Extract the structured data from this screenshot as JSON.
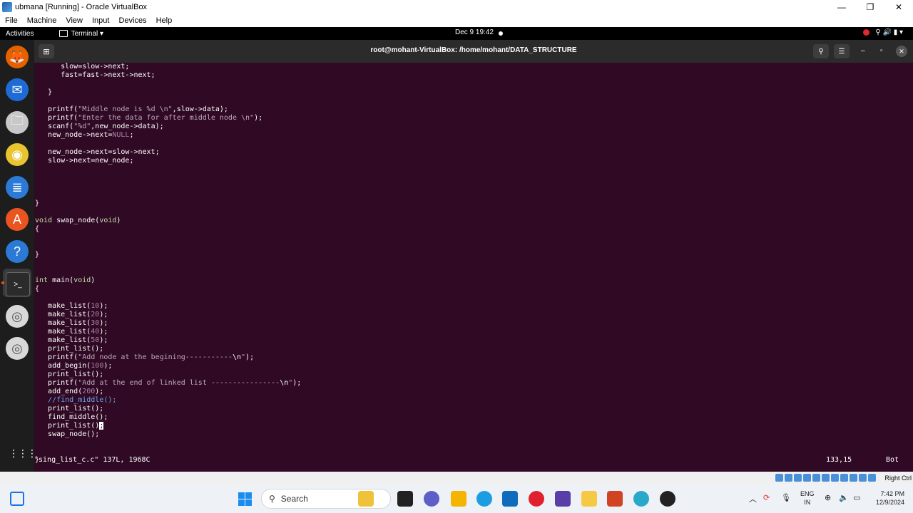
{
  "vbox": {
    "title": "ubmana [Running] - Oracle VirtualBox",
    "menu": [
      "File",
      "Machine",
      "View",
      "Input",
      "Devices",
      "Help"
    ],
    "minimize": "—",
    "restore": "❐",
    "close": "✕",
    "host_key": "Right Ctrl"
  },
  "ubuntu": {
    "activities": "Activities",
    "app_menu": "Terminal ▾",
    "clock": "Dec 9  19:42",
    "sys_icons": "⚲ 🔊 ▮ ▾"
  },
  "dock": {
    "items": [
      {
        "name": "firefox-icon",
        "glyph": "🦊",
        "color": "#e66000"
      },
      {
        "name": "thunderbird-icon",
        "glyph": "✉",
        "color": "#1f6bd6"
      },
      {
        "name": "files-icon",
        "glyph": "🗀",
        "color": "#c8c8c8"
      },
      {
        "name": "rhythmbox-icon",
        "glyph": "◉",
        "color": "#e8c430"
      },
      {
        "name": "writer-icon",
        "glyph": "≣",
        "color": "#2a7ad6"
      },
      {
        "name": "app-center-icon",
        "glyph": "A",
        "color": "#e95420"
      },
      {
        "name": "help-icon",
        "glyph": "?",
        "color": "#2a7ad6"
      },
      {
        "name": "terminal-icon",
        "glyph": ">_",
        "color": "#2b2b2b"
      },
      {
        "name": "disc-icon",
        "glyph": "◎",
        "color": "#d8d8d8"
      },
      {
        "name": "disc-icon-2",
        "glyph": "◎",
        "color": "#d8d8d8"
      }
    ],
    "show_apps": "⋮⋮⋮"
  },
  "terminal": {
    "new_tab": "⊞",
    "title": "root@mohant-VirtualBox: /home/mohant/DATA_STRUCTURE",
    "search": "⚲",
    "menu": "☰",
    "minimize": "–",
    "maximize": "▫",
    "close": "✕"
  },
  "code_lines": [
    [
      {
        "t": "      slow=slow->next;"
      }
    ],
    [
      {
        "t": "      fast=fast->next->next;"
      }
    ],
    [
      {
        "t": ""
      }
    ],
    [
      {
        "t": "   }"
      }
    ],
    [
      {
        "t": ""
      }
    ],
    [
      {
        "t": "   printf("
      },
      {
        "c": "str",
        "t": "\"Middle node is %d \\n\""
      },
      {
        "t": ",slow->data);"
      }
    ],
    [
      {
        "t": "   printf("
      },
      {
        "c": "str",
        "t": "\"Enter the data for after middle node \\n\""
      },
      {
        "t": ");"
      }
    ],
    [
      {
        "t": "   scanf("
      },
      {
        "c": "str",
        "t": "\"%d\""
      },
      {
        "t": ",new_node->data);"
      }
    ],
    [
      {
        "t": "   new_node->next="
      },
      {
        "c": "num",
        "t": "NULL"
      },
      {
        "t": ";"
      }
    ],
    [
      {
        "t": ""
      }
    ],
    [
      {
        "t": "   new_node->next=slow->next;"
      }
    ],
    [
      {
        "t": "   slow->next=new_node;"
      }
    ],
    [
      {
        "t": ""
      }
    ],
    [
      {
        "t": ""
      }
    ],
    [
      {
        "t": ""
      }
    ],
    [
      {
        "t": ""
      }
    ],
    [
      {
        "t": "}"
      }
    ],
    [
      {
        "t": ""
      }
    ],
    [
      {
        "c": "kw",
        "t": "void"
      },
      {
        "t": " swap_node("
      },
      {
        "c": "kw",
        "t": "void"
      },
      {
        "t": ")"
      }
    ],
    [
      {
        "t": "{"
      }
    ],
    [
      {
        "t": ""
      }
    ],
    [
      {
        "t": ""
      }
    ],
    [
      {
        "t": "}"
      }
    ],
    [
      {
        "t": ""
      }
    ],
    [
      {
        "t": ""
      }
    ],
    [
      {
        "c": "kw",
        "t": "int"
      },
      {
        "t": " main("
      },
      {
        "c": "kw",
        "t": "void"
      },
      {
        "t": ")"
      }
    ],
    [
      {
        "t": "{"
      }
    ],
    [
      {
        "t": ""
      }
    ],
    [
      {
        "t": "   make_list("
      },
      {
        "c": "num",
        "t": "10"
      },
      {
        "t": ");"
      }
    ],
    [
      {
        "t": "   make_list("
      },
      {
        "c": "num",
        "t": "20"
      },
      {
        "t": ");"
      }
    ],
    [
      {
        "t": "   make_list("
      },
      {
        "c": "num",
        "t": "30"
      },
      {
        "t": ");"
      }
    ],
    [
      {
        "t": "   make_list("
      },
      {
        "c": "num",
        "t": "40"
      },
      {
        "t": ");"
      }
    ],
    [
      {
        "t": "   make_list("
      },
      {
        "c": "num",
        "t": "50"
      },
      {
        "t": ");"
      }
    ],
    [
      {
        "t": "   print_list();"
      }
    ],
    [
      {
        "t": "   printf("
      },
      {
        "c": "str",
        "t": "\"Add node at the begining-----------"
      },
      {
        "t": "\\n"
      },
      {
        "c": "str",
        "t": "\""
      },
      {
        "t": ");"
      }
    ],
    [
      {
        "t": "   add_begin("
      },
      {
        "c": "num",
        "t": "100"
      },
      {
        "t": ");"
      }
    ],
    [
      {
        "t": "   print_list();"
      }
    ],
    [
      {
        "t": "   printf("
      },
      {
        "c": "str",
        "t": "\"Add at the end of linked list ----------------"
      },
      {
        "t": "\\n"
      },
      {
        "c": "str",
        "t": "\""
      },
      {
        "t": ");"
      }
    ],
    [
      {
        "t": "   add_end("
      },
      {
        "c": "num",
        "t": "200"
      },
      {
        "t": ");"
      }
    ],
    [
      {
        "c": "cmt",
        "t": "   //find_middle();"
      }
    ],
    [
      {
        "t": "   print_list();"
      }
    ],
    [
      {
        "t": "   find_middle();"
      }
    ],
    [
      {
        "t": "   print_list("
      },
      {
        "t": ")"
      },
      {
        "c": "cur",
        "t": ";"
      }
    ],
    [
      {
        "t": "   swap_node();"
      }
    ],
    [
      {
        "t": ""
      }
    ],
    [
      {
        "t": ""
      }
    ],
    [
      {
        "t": "}"
      }
    ]
  ],
  "status_bar": {
    "file": "\"sing_list_c.c\" 137L, 1968C",
    "position": "133,15",
    "scroll": "Bot"
  },
  "taskbar": {
    "search_placeholder": "Search",
    "lang_top": "ENG",
    "lang_bottom": "IN",
    "time": "7:42 PM",
    "date": "12/9/2024",
    "tray_chevron": "︿"
  }
}
